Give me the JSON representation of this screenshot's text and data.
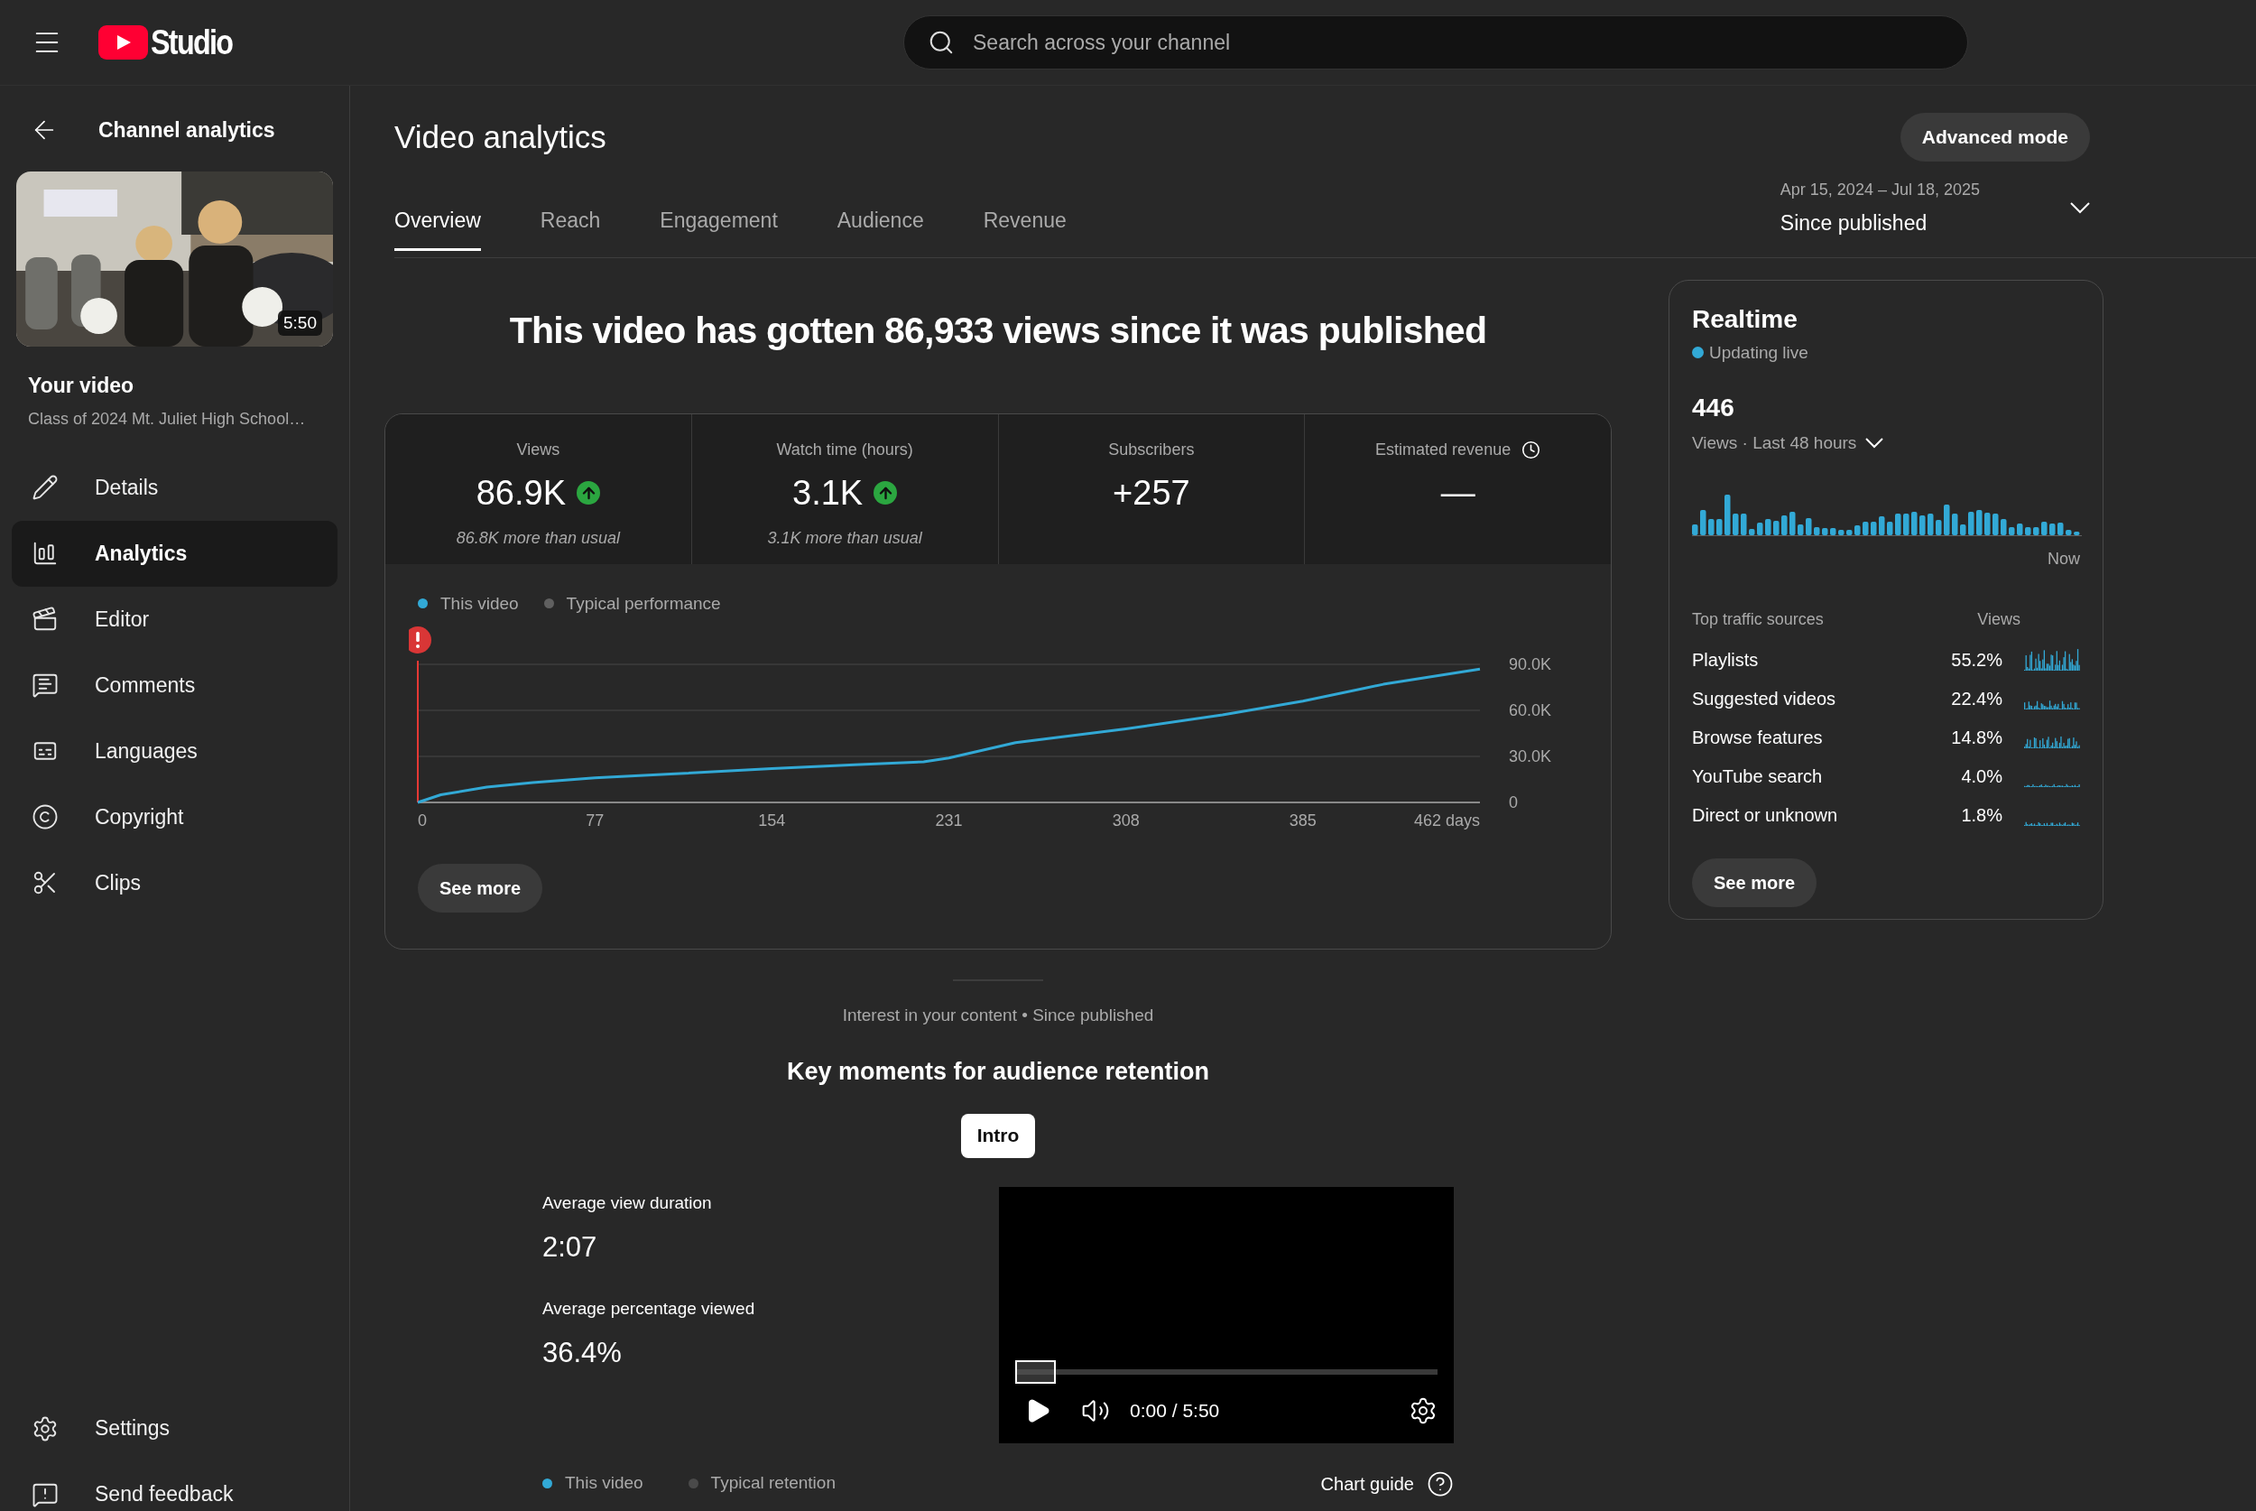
{
  "header": {
    "logo_text": "Studio",
    "search": {
      "placeholder": "Search across your channel"
    }
  },
  "sidebar": {
    "back_label": "Channel analytics",
    "video": {
      "duration": "5:50",
      "heading": "Your video",
      "title": "Class of 2024 Mt. Juliet High School…"
    },
    "items": [
      {
        "label": "Details",
        "selected": false
      },
      {
        "label": "Analytics",
        "selected": true
      },
      {
        "label": "Editor",
        "selected": false
      },
      {
        "label": "Comments",
        "selected": false
      },
      {
        "label": "Languages",
        "selected": false
      },
      {
        "label": "Copyright",
        "selected": false
      },
      {
        "label": "Clips",
        "selected": false
      }
    ],
    "footer_items": [
      {
        "label": "Settings"
      },
      {
        "label": "Send feedback"
      }
    ]
  },
  "page": {
    "title": "Video analytics",
    "advanced_button": "Advanced mode",
    "tabs": [
      {
        "label": "Overview",
        "selected": true
      },
      {
        "label": "Reach",
        "selected": false
      },
      {
        "label": "Engagement",
        "selected": false
      },
      {
        "label": "Audience",
        "selected": false
      },
      {
        "label": "Revenue",
        "selected": false
      }
    ],
    "date_range": {
      "dates": "Apr 15, 2024 – Jul 18, 2025",
      "label": "Since published"
    }
  },
  "summary": {
    "headline": "This video has gotten 86,933 views since it was published"
  },
  "metrics": [
    {
      "kind": "metric",
      "label": "Views",
      "value": "86.9K",
      "rising": true,
      "note": "86.8K more than usual"
    },
    {
      "kind": "metric",
      "label": "Watch time (hours)",
      "value": "3.1K",
      "rising": true,
      "note": "3.1K more than usual"
    },
    {
      "kind": "metric",
      "label": "Subscribers",
      "value": "+257"
    },
    {
      "kind": "estimate",
      "label": "Estimated revenue",
      "value": "—"
    }
  ],
  "views_chart": {
    "legend": [
      {
        "label": "Typical performance",
        "color": "#606060"
      }
    ],
    "chart_data": {
      "type": "line",
      "x": [
        0,
        10,
        30,
        50,
        77,
        110,
        154,
        190,
        220,
        231,
        260,
        308,
        350,
        385,
        420,
        462
      ],
      "series": [
        {
          "name": "This video",
          "color": "#32a9d6",
          "values": [
            0,
            5000,
            10000,
            13000,
            16000,
            18500,
            22000,
            24500,
            26500,
            29000,
            39000,
            48000,
            57000,
            66000,
            77000,
            86900
          ]
        }
      ],
      "xlim": [
        0,
        462
      ],
      "ylim": [
        0,
        90000
      ],
      "xticks": [
        0,
        77,
        154,
        231,
        308,
        385,
        {
          "value": 462,
          "label": "462 days"
        }
      ],
      "yticks": [
        0,
        {
          "value": 30000,
          "label": "30.0K"
        },
        {
          "value": 60000,
          "label": "60.0K"
        },
        {
          "value": 90000,
          "label": "90.0K"
        }
      ]
    },
    "button": "See more"
  },
  "retention": {
    "context": "Interest in your content • Since published",
    "title": "Key moments for audience retention",
    "moments": [
      {
        "label": "Intro",
        "selected": true
      }
    ],
    "stats": [
      {
        "label": "Average view duration",
        "value": "2:07"
      },
      {
        "label": "Average percentage viewed",
        "value": "36.4%"
      }
    ],
    "player": {
      "time": "0:00 / 5:50"
    },
    "legend": [
      {
        "label": "This video",
        "color": "#32a9d6"
      },
      {
        "label": "Typical retention",
        "color": "#4a4a4a"
      }
    ],
    "guide": "Chart guide"
  },
  "realtime": {
    "title": "Realtime",
    "status": "Updating live",
    "count": "446",
    "period": "Views · Last 48 hours",
    "now_label": "Now",
    "sources_header": "Top traffic sources",
    "views_header": "Views",
    "sources": [
      {
        "name": "Playlists",
        "share": "55.2%"
      },
      {
        "name": "Suggested videos",
        "share": "22.4%"
      },
      {
        "name": "Browse features",
        "share": "14.8%"
      },
      {
        "name": "YouTube search",
        "share": "4.0%"
      },
      {
        "name": "Direct or unknown",
        "share": "1.8%"
      }
    ],
    "button": "See more"
  }
}
